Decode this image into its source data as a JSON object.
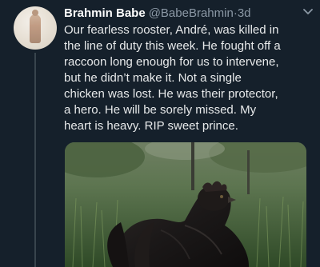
{
  "tweet": {
    "author": {
      "display_name": "Brahmin Babe",
      "handle": "@BabeBrahmin",
      "separator": " · ",
      "time": "3d"
    },
    "text": "Our fearless rooster, André, was killed in\nthe line of duty this week. He fought off a\nraccoon long enough for us to intervene,\nbut he didn’t make it. Not a single\nchicken was lost. He was their protector,\na hero. He will be sorely missed. My\nheart is heavy. RIP sweet prince.",
    "menu_icon": "chevron-down-icon",
    "media": {
      "type": "photo",
      "subject": "black rooster in grass"
    }
  },
  "colors": {
    "background": "#15202b",
    "text": "#e7e9ea",
    "secondary_text": "#8b98a5",
    "thread_line": "#38444d"
  }
}
